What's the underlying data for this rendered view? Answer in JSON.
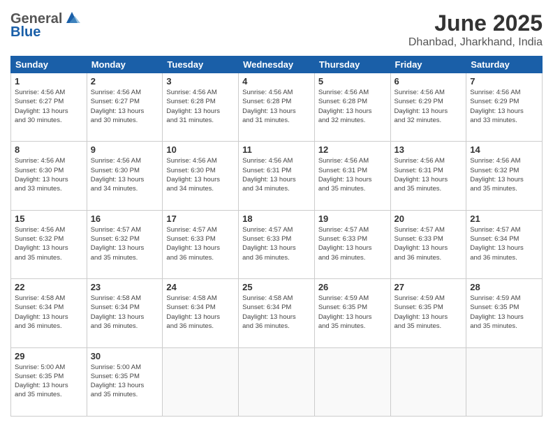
{
  "logo": {
    "general": "General",
    "blue": "Blue"
  },
  "title": "June 2025",
  "location": "Dhanbad, Jharkhand, India",
  "headers": [
    "Sunday",
    "Monday",
    "Tuesday",
    "Wednesday",
    "Thursday",
    "Friday",
    "Saturday"
  ],
  "weeks": [
    [
      {
        "day": "1",
        "info": "Sunrise: 4:56 AM\nSunset: 6:27 PM\nDaylight: 13 hours\nand 30 minutes."
      },
      {
        "day": "2",
        "info": "Sunrise: 4:56 AM\nSunset: 6:27 PM\nDaylight: 13 hours\nand 30 minutes."
      },
      {
        "day": "3",
        "info": "Sunrise: 4:56 AM\nSunset: 6:28 PM\nDaylight: 13 hours\nand 31 minutes."
      },
      {
        "day": "4",
        "info": "Sunrise: 4:56 AM\nSunset: 6:28 PM\nDaylight: 13 hours\nand 31 minutes."
      },
      {
        "day": "5",
        "info": "Sunrise: 4:56 AM\nSunset: 6:28 PM\nDaylight: 13 hours\nand 32 minutes."
      },
      {
        "day": "6",
        "info": "Sunrise: 4:56 AM\nSunset: 6:29 PM\nDaylight: 13 hours\nand 32 minutes."
      },
      {
        "day": "7",
        "info": "Sunrise: 4:56 AM\nSunset: 6:29 PM\nDaylight: 13 hours\nand 33 minutes."
      }
    ],
    [
      {
        "day": "8",
        "info": "Sunrise: 4:56 AM\nSunset: 6:30 PM\nDaylight: 13 hours\nand 33 minutes."
      },
      {
        "day": "9",
        "info": "Sunrise: 4:56 AM\nSunset: 6:30 PM\nDaylight: 13 hours\nand 34 minutes."
      },
      {
        "day": "10",
        "info": "Sunrise: 4:56 AM\nSunset: 6:30 PM\nDaylight: 13 hours\nand 34 minutes."
      },
      {
        "day": "11",
        "info": "Sunrise: 4:56 AM\nSunset: 6:31 PM\nDaylight: 13 hours\nand 34 minutes."
      },
      {
        "day": "12",
        "info": "Sunrise: 4:56 AM\nSunset: 6:31 PM\nDaylight: 13 hours\nand 35 minutes."
      },
      {
        "day": "13",
        "info": "Sunrise: 4:56 AM\nSunset: 6:31 PM\nDaylight: 13 hours\nand 35 minutes."
      },
      {
        "day": "14",
        "info": "Sunrise: 4:56 AM\nSunset: 6:32 PM\nDaylight: 13 hours\nand 35 minutes."
      }
    ],
    [
      {
        "day": "15",
        "info": "Sunrise: 4:56 AM\nSunset: 6:32 PM\nDaylight: 13 hours\nand 35 minutes."
      },
      {
        "day": "16",
        "info": "Sunrise: 4:57 AM\nSunset: 6:32 PM\nDaylight: 13 hours\nand 35 minutes."
      },
      {
        "day": "17",
        "info": "Sunrise: 4:57 AM\nSunset: 6:33 PM\nDaylight: 13 hours\nand 36 minutes."
      },
      {
        "day": "18",
        "info": "Sunrise: 4:57 AM\nSunset: 6:33 PM\nDaylight: 13 hours\nand 36 minutes."
      },
      {
        "day": "19",
        "info": "Sunrise: 4:57 AM\nSunset: 6:33 PM\nDaylight: 13 hours\nand 36 minutes."
      },
      {
        "day": "20",
        "info": "Sunrise: 4:57 AM\nSunset: 6:33 PM\nDaylight: 13 hours\nand 36 minutes."
      },
      {
        "day": "21",
        "info": "Sunrise: 4:57 AM\nSunset: 6:34 PM\nDaylight: 13 hours\nand 36 minutes."
      }
    ],
    [
      {
        "day": "22",
        "info": "Sunrise: 4:58 AM\nSunset: 6:34 PM\nDaylight: 13 hours\nand 36 minutes."
      },
      {
        "day": "23",
        "info": "Sunrise: 4:58 AM\nSunset: 6:34 PM\nDaylight: 13 hours\nand 36 minutes."
      },
      {
        "day": "24",
        "info": "Sunrise: 4:58 AM\nSunset: 6:34 PM\nDaylight: 13 hours\nand 36 minutes."
      },
      {
        "day": "25",
        "info": "Sunrise: 4:58 AM\nSunset: 6:34 PM\nDaylight: 13 hours\nand 36 minutes."
      },
      {
        "day": "26",
        "info": "Sunrise: 4:59 AM\nSunset: 6:35 PM\nDaylight: 13 hours\nand 35 minutes."
      },
      {
        "day": "27",
        "info": "Sunrise: 4:59 AM\nSunset: 6:35 PM\nDaylight: 13 hours\nand 35 minutes."
      },
      {
        "day": "28",
        "info": "Sunrise: 4:59 AM\nSunset: 6:35 PM\nDaylight: 13 hours\nand 35 minutes."
      }
    ],
    [
      {
        "day": "29",
        "info": "Sunrise: 5:00 AM\nSunset: 6:35 PM\nDaylight: 13 hours\nand 35 minutes."
      },
      {
        "day": "30",
        "info": "Sunrise: 5:00 AM\nSunset: 6:35 PM\nDaylight: 13 hours\nand 35 minutes."
      },
      {
        "day": "",
        "info": ""
      },
      {
        "day": "",
        "info": ""
      },
      {
        "day": "",
        "info": ""
      },
      {
        "day": "",
        "info": ""
      },
      {
        "day": "",
        "info": ""
      }
    ]
  ]
}
